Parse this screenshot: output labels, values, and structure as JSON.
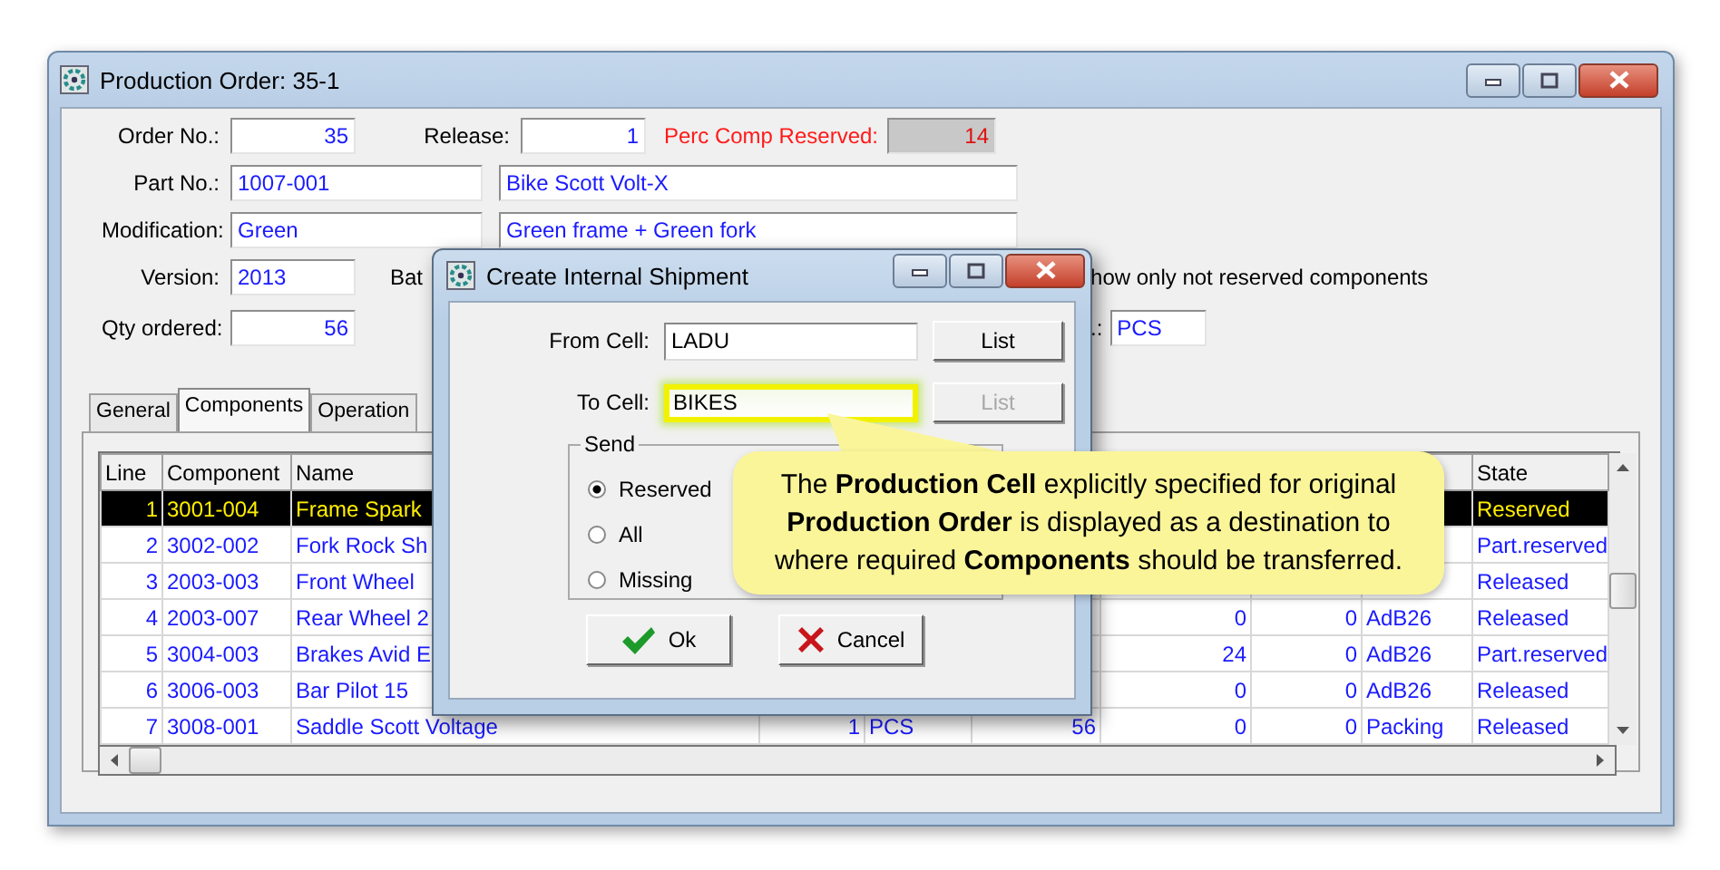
{
  "window": {
    "title": "Production Order: 35-1"
  },
  "form": {
    "order_no": {
      "label": "Order No.:",
      "value": "35"
    },
    "release": {
      "label": "Release:",
      "value": "1"
    },
    "perc_comp_reserved": {
      "label": "Perc Comp Reserved:",
      "value": "14"
    },
    "part_no": {
      "label": "Part No.:",
      "value": "1007-001",
      "description": "Bike Scott Volt-X"
    },
    "modification": {
      "label": "Modification:",
      "value": "Green",
      "description": "Green frame + Green fork"
    },
    "version": {
      "label": "Version:",
      "value": "2013"
    },
    "batch_label": "Bat",
    "show_only_not_reserved": {
      "label": "how only not reserved components"
    },
    "qty_ordered": {
      "label": "Qty ordered:",
      "value": "56"
    },
    "unit": {
      "label": ".:",
      "value": "PCS"
    }
  },
  "tabs": [
    {
      "label": "General",
      "selected": false
    },
    {
      "label": "Components",
      "selected": true
    },
    {
      "label": "Operation",
      "selected": false
    }
  ],
  "table": {
    "columns": [
      "Line",
      "Component",
      "Name",
      null,
      null,
      null,
      null,
      null,
      null,
      "State"
    ],
    "rows": [
      {
        "selected": true,
        "cells": [
          "1",
          "3001-004",
          "Frame Spark",
          null,
          null,
          null,
          null,
          null,
          null,
          "Reserved"
        ]
      },
      {
        "selected": false,
        "cells": [
          "2",
          "3002-002",
          "Fork Rock Sh",
          null,
          null,
          null,
          null,
          null,
          null,
          "Part.reserved"
        ]
      },
      {
        "selected": false,
        "cells": [
          "3",
          "2003-003",
          "Front Wheel",
          null,
          null,
          null,
          null,
          null,
          null,
          "Released"
        ]
      },
      {
        "selected": false,
        "cells": [
          "4",
          "2003-007",
          "Rear Wheel 2",
          null,
          null,
          null,
          "0",
          "0",
          "AdB26",
          "Released"
        ]
      },
      {
        "selected": false,
        "cells": [
          "5",
          "3004-003",
          "Brakes Avid E",
          null,
          null,
          null,
          "24",
          "0",
          "AdB26",
          "Part.reserved"
        ]
      },
      {
        "selected": false,
        "cells": [
          "6",
          "3006-003",
          "Bar Pilot 15",
          null,
          null,
          null,
          "0",
          "0",
          "AdB26",
          "Released"
        ]
      },
      {
        "selected": false,
        "cells": [
          "7",
          "3008-001",
          "Saddle Scott Voltage",
          "1",
          "PCS",
          "56",
          "0",
          "0",
          "Packing",
          "Released"
        ]
      }
    ]
  },
  "dialog": {
    "title": "Create Internal Shipment",
    "from_cell": {
      "label": "From Cell:",
      "value": "LADU",
      "button": "List",
      "disabled": false
    },
    "to_cell": {
      "label": "To Cell:",
      "value": "BIKES",
      "button": "List",
      "highlighted": true,
      "disabled": true
    },
    "send": {
      "label": "Send",
      "options": [
        {
          "label": "Reserved",
          "selected": true
        },
        {
          "label": "All",
          "selected": false
        },
        {
          "label": "Missing",
          "selected": false
        }
      ]
    },
    "buttons": [
      {
        "kind": "ok",
        "label": "Ok"
      },
      {
        "kind": "cancel",
        "label": "Cancel"
      }
    ]
  },
  "callout": {
    "text": "The **Production Cell** explicitly specified for original **Production Order** is displayed as a destination to where required **Components** should be transferred."
  }
}
